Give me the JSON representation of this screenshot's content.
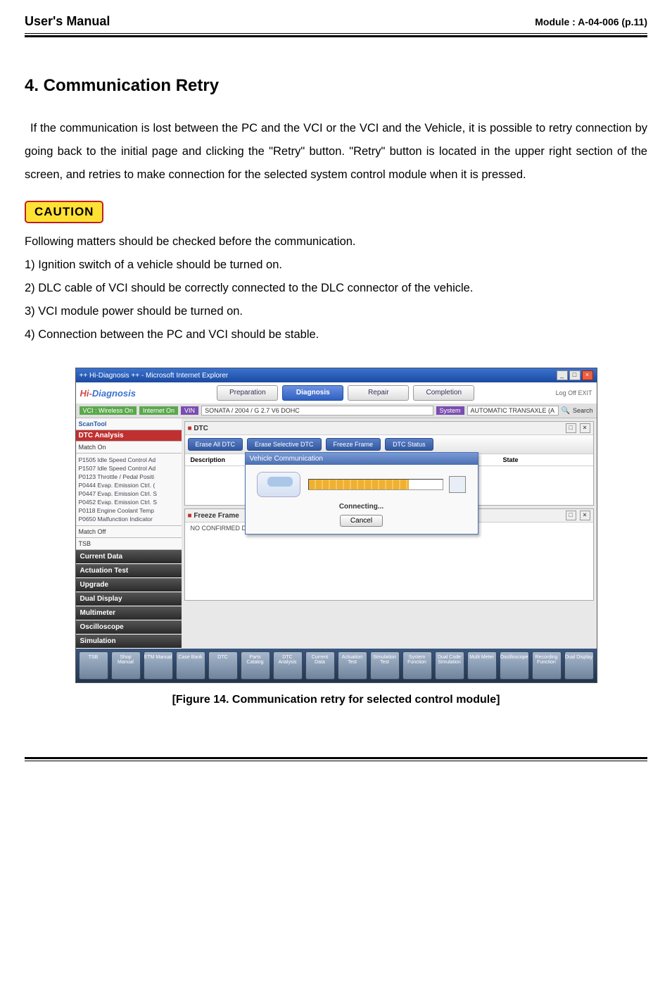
{
  "header": {
    "left": "User's Manual",
    "right": "Module : A-04-006 (p.11)"
  },
  "section_title": "4. Communication Retry",
  "paragraph": "If the communication is lost between the PC and the VCI or the VCI and the Vehicle, it is possible to retry connection by going back to the initial page and clicking the \"Retry\" button. \"Retry\" button is located in the upper right section of the screen, and retries to make connection for the selected system control module when it is pressed.",
  "caution_label": "CAUTION",
  "check_intro": "Following matters should be checked before the communication.",
  "checks": [
    "1) Ignition switch of a vehicle should be turned on.",
    "2) DLC cable of VCI should be correctly connected to the DLC connector of the vehicle.",
    "3) VCI module power should be turned on.",
    "4) Connection between the PC and VCI should be stable."
  ],
  "screenshot": {
    "window_title": "++ Hi-Diagnosis ++ - Microsoft Internet Explorer",
    "brand": {
      "part1": "Hi-",
      "part2": "Diagnosis"
    },
    "topnav": [
      "Preparation",
      "Diagnosis",
      "Repair",
      "Completion"
    ],
    "topnav_active_index": 1,
    "toplinks": "Log Off    EXIT",
    "infobar": {
      "tag1": "VCI : Wireless On",
      "tag2": "Internet On",
      "vin_label": "VIN",
      "vin_value": "SONATA / 2004 / G 2.7 V6 DOHC",
      "sys_label": "System",
      "sys_value": "AUTOMATIC TRANSAXLE (A",
      "search_label": "Search"
    },
    "side": {
      "scan": "ScanTool",
      "dtc_head": "DTC Analysis",
      "match_on": "Match On",
      "dtc_list": [
        "P1505 Idle Speed Control Ad",
        "P1507 Idle Speed Control Ad",
        "P0123 Throttle / Pedal Positi",
        "P0444 Evap. Emission Ctrl. (",
        "P0447 Evap. Emission Ctrl. S",
        "P0452 Evap. Emission Ctrl. S",
        "P0118 Engine Coolant Temp",
        "P0650 Malfunction Indicator"
      ],
      "match_off": "Match Off",
      "tsb": "TSB",
      "items": [
        "Current Data",
        "Actuation Test",
        "Upgrade",
        "Dual Display",
        "Multimeter",
        "Oscilloscope",
        "Simulation"
      ]
    },
    "dtc_panel": {
      "title": "DTC",
      "btns": [
        "Erase All DTC",
        "Erase Selective DTC",
        "Freeze Frame",
        "DTC Status"
      ],
      "col1": "Description",
      "col2": "State"
    },
    "freeze_panel": {
      "title": "Freeze Frame",
      "line": "NO CONFIRMED DTC"
    },
    "modal": {
      "title": "Vehicle Communication",
      "status": "Connecting...",
      "button": "Cancel"
    },
    "iconbar": [
      "TSB",
      "Shop Manual",
      "ETM Manual",
      "Case Bank",
      "DTC",
      "Parts Catalog",
      "DTC Analysis",
      "Current Data",
      "Actuation Test",
      "Simulation Test",
      "System Function",
      "Dual Code Simulation",
      "Multi Meter",
      "Oscilloscope",
      "Recording Function",
      "Dual Display"
    ]
  },
  "figure_caption": "[Figure 14. Communication retry for selected control module]"
}
